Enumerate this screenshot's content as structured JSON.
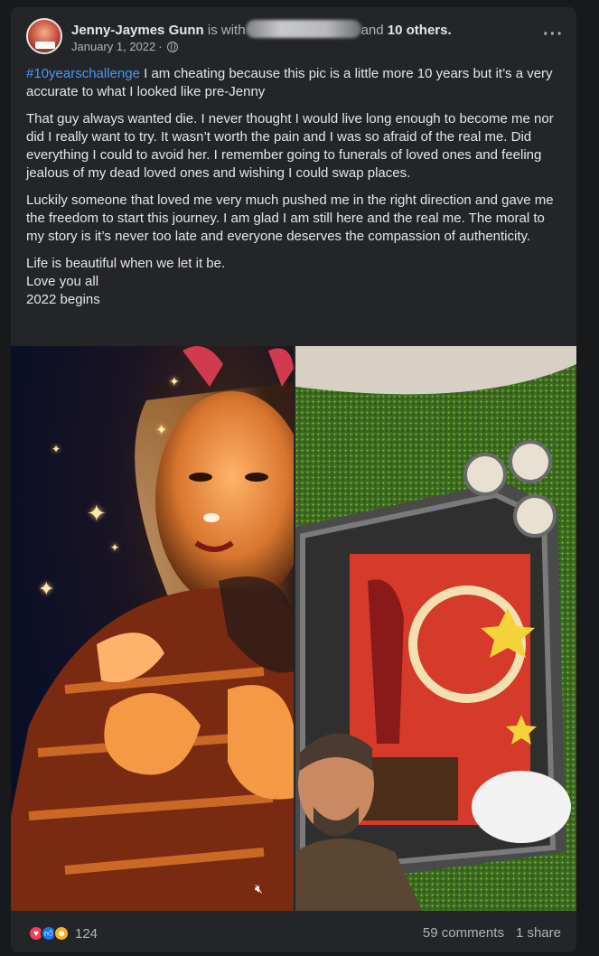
{
  "post": {
    "author_name": "Jenny-Jaymes Gunn",
    "with_text": "is with",
    "and_text": "and",
    "others_text": "10 others.",
    "date": "January 1, 2022",
    "separator": "·",
    "audience_icon": "globe-icon",
    "more_label": "···",
    "hashtag": "#10yearschallenge",
    "first_line_rest": " I am cheating because this pic is a little more 10 years but it’s a very accurate to what I looked like pre-Jenny",
    "paragraph2": "That guy always wanted die. I never thought I would live long enough to become me nor did I really want to try. It wasn’t worth the pain and I was so afraid of the real me. Did everything I could to avoid her. I remember going to funerals of loved ones and feeling jealous of my dead loved ones and wishing I could swap places.",
    "paragraph3": "Luckily someone that loved me very much pushed me in the right direction and gave me the freedom to start this journey. I am glad I am still here and the real me. The moral to my story is it’s never too late and everyone deserves the compassion of authenticity.",
    "closing_lines": [
      "Life is beautiful when we let it be.",
      "Love you all",
      "2022 begins"
    ]
  },
  "photos": {
    "mute_icon": "speaker-muted-icon"
  },
  "footer": {
    "reaction_icons": [
      "love-icon",
      "like-icon",
      "care-icon"
    ],
    "reaction_count": "124",
    "comments": "59 comments",
    "shares": "1 share"
  },
  "colors": {
    "background": "#18191a",
    "card": "#242526",
    "text_primary": "#e4e6eb",
    "text_secondary": "#b0b3b8",
    "hashtag": "#4599ff"
  }
}
